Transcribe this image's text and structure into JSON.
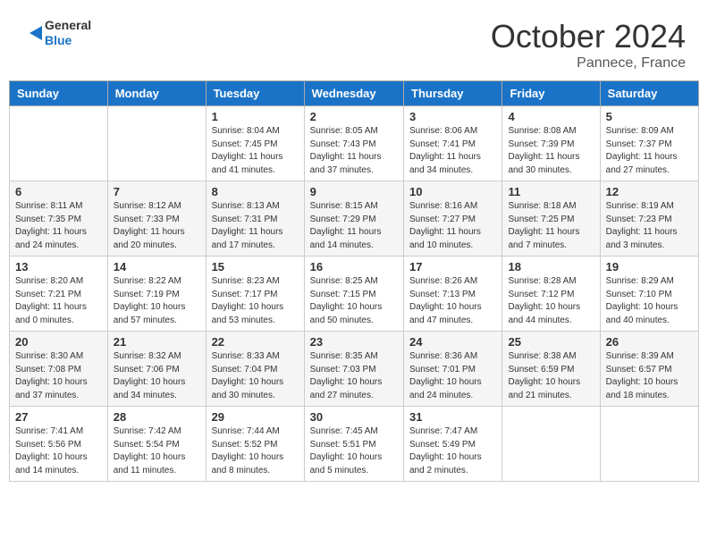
{
  "header": {
    "logo_line1": "General",
    "logo_line2": "Blue",
    "month": "October 2024",
    "location": "Pannece, France"
  },
  "columns": [
    "Sunday",
    "Monday",
    "Tuesday",
    "Wednesday",
    "Thursday",
    "Friday",
    "Saturday"
  ],
  "weeks": [
    [
      {
        "day": "",
        "sunrise": "",
        "sunset": "",
        "daylight": ""
      },
      {
        "day": "",
        "sunrise": "",
        "sunset": "",
        "daylight": ""
      },
      {
        "day": "1",
        "sunrise": "Sunrise: 8:04 AM",
        "sunset": "Sunset: 7:45 PM",
        "daylight": "Daylight: 11 hours and 41 minutes."
      },
      {
        "day": "2",
        "sunrise": "Sunrise: 8:05 AM",
        "sunset": "Sunset: 7:43 PM",
        "daylight": "Daylight: 11 hours and 37 minutes."
      },
      {
        "day": "3",
        "sunrise": "Sunrise: 8:06 AM",
        "sunset": "Sunset: 7:41 PM",
        "daylight": "Daylight: 11 hours and 34 minutes."
      },
      {
        "day": "4",
        "sunrise": "Sunrise: 8:08 AM",
        "sunset": "Sunset: 7:39 PM",
        "daylight": "Daylight: 11 hours and 30 minutes."
      },
      {
        "day": "5",
        "sunrise": "Sunrise: 8:09 AM",
        "sunset": "Sunset: 7:37 PM",
        "daylight": "Daylight: 11 hours and 27 minutes."
      }
    ],
    [
      {
        "day": "6",
        "sunrise": "Sunrise: 8:11 AM",
        "sunset": "Sunset: 7:35 PM",
        "daylight": "Daylight: 11 hours and 24 minutes."
      },
      {
        "day": "7",
        "sunrise": "Sunrise: 8:12 AM",
        "sunset": "Sunset: 7:33 PM",
        "daylight": "Daylight: 11 hours and 20 minutes."
      },
      {
        "day": "8",
        "sunrise": "Sunrise: 8:13 AM",
        "sunset": "Sunset: 7:31 PM",
        "daylight": "Daylight: 11 hours and 17 minutes."
      },
      {
        "day": "9",
        "sunrise": "Sunrise: 8:15 AM",
        "sunset": "Sunset: 7:29 PM",
        "daylight": "Daylight: 11 hours and 14 minutes."
      },
      {
        "day": "10",
        "sunrise": "Sunrise: 8:16 AM",
        "sunset": "Sunset: 7:27 PM",
        "daylight": "Daylight: 11 hours and 10 minutes."
      },
      {
        "day": "11",
        "sunrise": "Sunrise: 8:18 AM",
        "sunset": "Sunset: 7:25 PM",
        "daylight": "Daylight: 11 hours and 7 minutes."
      },
      {
        "day": "12",
        "sunrise": "Sunrise: 8:19 AM",
        "sunset": "Sunset: 7:23 PM",
        "daylight": "Daylight: 11 hours and 3 minutes."
      }
    ],
    [
      {
        "day": "13",
        "sunrise": "Sunrise: 8:20 AM",
        "sunset": "Sunset: 7:21 PM",
        "daylight": "Daylight: 11 hours and 0 minutes."
      },
      {
        "day": "14",
        "sunrise": "Sunrise: 8:22 AM",
        "sunset": "Sunset: 7:19 PM",
        "daylight": "Daylight: 10 hours and 57 minutes."
      },
      {
        "day": "15",
        "sunrise": "Sunrise: 8:23 AM",
        "sunset": "Sunset: 7:17 PM",
        "daylight": "Daylight: 10 hours and 53 minutes."
      },
      {
        "day": "16",
        "sunrise": "Sunrise: 8:25 AM",
        "sunset": "Sunset: 7:15 PM",
        "daylight": "Daylight: 10 hours and 50 minutes."
      },
      {
        "day": "17",
        "sunrise": "Sunrise: 8:26 AM",
        "sunset": "Sunset: 7:13 PM",
        "daylight": "Daylight: 10 hours and 47 minutes."
      },
      {
        "day": "18",
        "sunrise": "Sunrise: 8:28 AM",
        "sunset": "Sunset: 7:12 PM",
        "daylight": "Daylight: 10 hours and 44 minutes."
      },
      {
        "day": "19",
        "sunrise": "Sunrise: 8:29 AM",
        "sunset": "Sunset: 7:10 PM",
        "daylight": "Daylight: 10 hours and 40 minutes."
      }
    ],
    [
      {
        "day": "20",
        "sunrise": "Sunrise: 8:30 AM",
        "sunset": "Sunset: 7:08 PM",
        "daylight": "Daylight: 10 hours and 37 minutes."
      },
      {
        "day": "21",
        "sunrise": "Sunrise: 8:32 AM",
        "sunset": "Sunset: 7:06 PM",
        "daylight": "Daylight: 10 hours and 34 minutes."
      },
      {
        "day": "22",
        "sunrise": "Sunrise: 8:33 AM",
        "sunset": "Sunset: 7:04 PM",
        "daylight": "Daylight: 10 hours and 30 minutes."
      },
      {
        "day": "23",
        "sunrise": "Sunrise: 8:35 AM",
        "sunset": "Sunset: 7:03 PM",
        "daylight": "Daylight: 10 hours and 27 minutes."
      },
      {
        "day": "24",
        "sunrise": "Sunrise: 8:36 AM",
        "sunset": "Sunset: 7:01 PM",
        "daylight": "Daylight: 10 hours and 24 minutes."
      },
      {
        "day": "25",
        "sunrise": "Sunrise: 8:38 AM",
        "sunset": "Sunset: 6:59 PM",
        "daylight": "Daylight: 10 hours and 21 minutes."
      },
      {
        "day": "26",
        "sunrise": "Sunrise: 8:39 AM",
        "sunset": "Sunset: 6:57 PM",
        "daylight": "Daylight: 10 hours and 18 minutes."
      }
    ],
    [
      {
        "day": "27",
        "sunrise": "Sunrise: 7:41 AM",
        "sunset": "Sunset: 5:56 PM",
        "daylight": "Daylight: 10 hours and 14 minutes."
      },
      {
        "day": "28",
        "sunrise": "Sunrise: 7:42 AM",
        "sunset": "Sunset: 5:54 PM",
        "daylight": "Daylight: 10 hours and 11 minutes."
      },
      {
        "day": "29",
        "sunrise": "Sunrise: 7:44 AM",
        "sunset": "Sunset: 5:52 PM",
        "daylight": "Daylight: 10 hours and 8 minutes."
      },
      {
        "day": "30",
        "sunrise": "Sunrise: 7:45 AM",
        "sunset": "Sunset: 5:51 PM",
        "daylight": "Daylight: 10 hours and 5 minutes."
      },
      {
        "day": "31",
        "sunrise": "Sunrise: 7:47 AM",
        "sunset": "Sunset: 5:49 PM",
        "daylight": "Daylight: 10 hours and 2 minutes."
      },
      {
        "day": "",
        "sunrise": "",
        "sunset": "",
        "daylight": ""
      },
      {
        "day": "",
        "sunrise": "",
        "sunset": "",
        "daylight": ""
      }
    ]
  ]
}
